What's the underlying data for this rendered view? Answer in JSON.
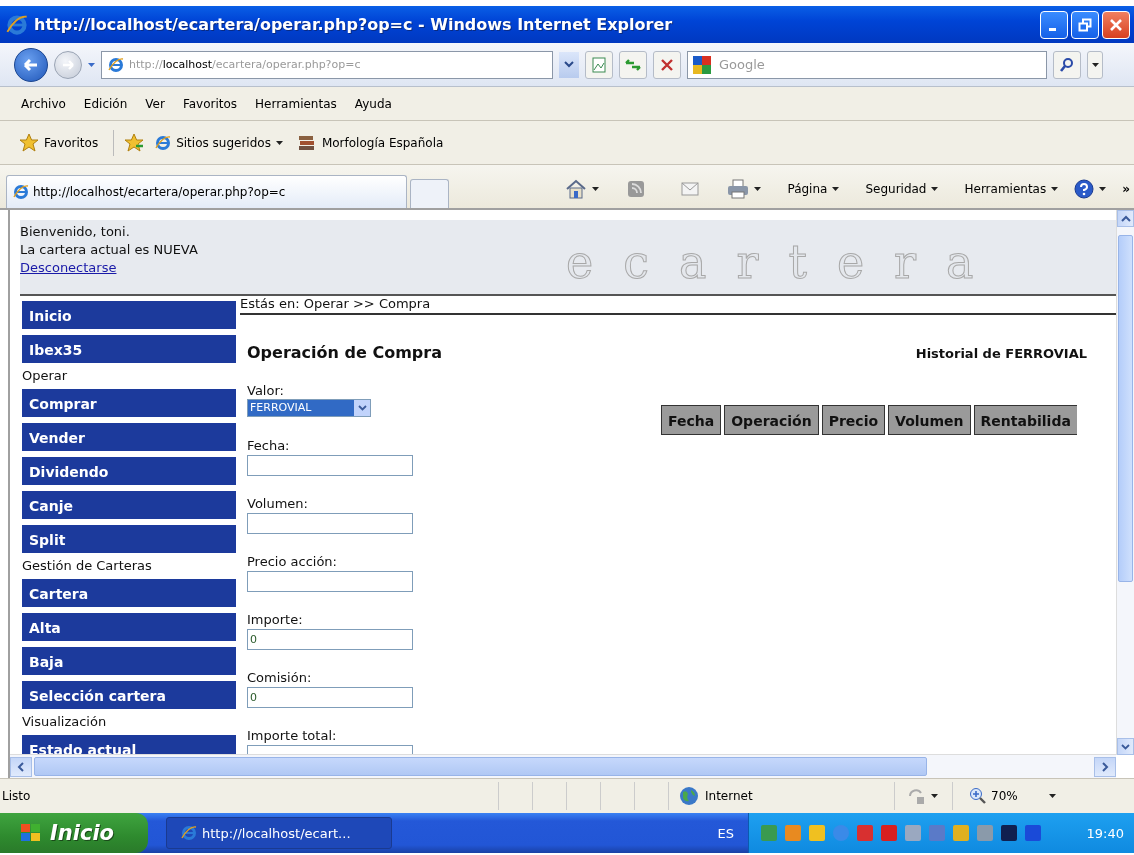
{
  "window": {
    "title": "http://localhost/ecartera/operar.php?op=c - Windows Internet Explorer"
  },
  "navigation": {
    "address": "http://**localhost**/ecartera/operar.php?op=c",
    "search": {
      "placeholder": "Google"
    }
  },
  "menu": [
    "Archivo",
    "Edición",
    "Ver",
    "Favoritos",
    "Herramientas",
    "Ayuda"
  ],
  "favorites_bar": {
    "label": "Favoritos",
    "items": [
      {
        "label": "Sitios sugeridos",
        "dropdown": true
      },
      {
        "label": "Morfología Española",
        "dropdown": false
      }
    ]
  },
  "tab": {
    "title": "http://localhost/ecartera/operar.php?op=c"
  },
  "command_bar": {
    "menus": [
      "Página",
      "Seguridad",
      "Herramientas"
    ],
    "overflow": "»"
  },
  "page": {
    "header": {
      "greeting": "Bienvenido, toni.",
      "portfolio": "La cartera actual es NUEVA",
      "logout": "Desconectarse",
      "logo": "ecartera"
    },
    "breadcrumb": "Estás en: Operar >> Compra",
    "sidebar": [
      {
        "kind": "link",
        "label": "Inicio"
      },
      {
        "kind": "link",
        "label": "Ibex35"
      },
      {
        "kind": "heading",
        "label": "Operar"
      },
      {
        "kind": "link",
        "label": "Comprar"
      },
      {
        "kind": "link",
        "label": "Vender"
      },
      {
        "kind": "link",
        "label": "Dividendo"
      },
      {
        "kind": "link",
        "label": "Canje"
      },
      {
        "kind": "link",
        "label": "Split"
      },
      {
        "kind": "heading",
        "label": "Gestión de Carteras"
      },
      {
        "kind": "link",
        "label": "Cartera"
      },
      {
        "kind": "link",
        "label": "Alta"
      },
      {
        "kind": "link",
        "label": "Baja"
      },
      {
        "kind": "link",
        "label": "Selección cartera"
      },
      {
        "kind": "heading",
        "label": "Visualización"
      },
      {
        "kind": "link",
        "label": "Estado actual"
      }
    ],
    "form": {
      "title": "Operación de Compra",
      "fields": [
        {
          "kind": "select",
          "label": "Valor:",
          "value": "FERROVIAL"
        },
        {
          "kind": "text",
          "label": "Fecha:"
        },
        {
          "kind": "text",
          "label": "Volumen:"
        },
        {
          "kind": "text",
          "label": "Precio acción:"
        },
        {
          "kind": "text",
          "label": "Importe:",
          "value": "0"
        },
        {
          "kind": "text",
          "label": "Comisión:",
          "value": "0"
        },
        {
          "kind": "text",
          "label": "Importe total:"
        }
      ]
    },
    "history": {
      "title": "Historial de FERROVIAL",
      "columns": [
        "Fecha",
        "Operación",
        "Precio",
        "Volumen",
        "Rentabilida"
      ]
    }
  },
  "status_bar": {
    "text": "Listo",
    "zone": "Internet",
    "zoom": "70%"
  },
  "taskbar": {
    "start": "Inicio",
    "task": "http://localhost/ecart...",
    "language": "ES",
    "clock": "19:40"
  }
}
